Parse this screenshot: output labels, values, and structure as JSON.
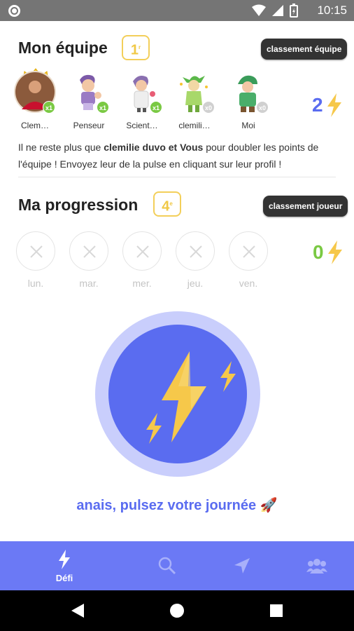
{
  "status_bar": {
    "time": "10:15"
  },
  "team": {
    "title": "Mon équipe",
    "rank": "1",
    "rank_suffix": "r",
    "button_label": "classement équipe",
    "score": "2",
    "members": [
      {
        "name": "Clem…",
        "multiplier": "x1",
        "active": true,
        "crown": true
      },
      {
        "name": "Penseur",
        "multiplier": "x1",
        "active": true
      },
      {
        "name": "Scient…",
        "multiplier": "x1",
        "active": true
      },
      {
        "name": "clemili…",
        "multiplier": "x0",
        "active": false
      },
      {
        "name": "Moi",
        "multiplier": "x0",
        "active": false
      }
    ],
    "message": {
      "prefix": "Il ne reste plus que ",
      "highlight": "clemilie duvo et Vous",
      "suffix": " pour doubler les points de l'équipe ! Envoyez leur de la pulse en cliquant sur leur profil !"
    }
  },
  "progression": {
    "title": "Ma progression",
    "rank": "4",
    "rank_suffix": "e",
    "button_label": "classement joueur",
    "score": "0",
    "days": [
      "lun.",
      "mar.",
      "mer.",
      "jeu.",
      "ven."
    ]
  },
  "cta": {
    "text": "anais, pulsez votre journée 🚀"
  },
  "bottom_nav": {
    "items": [
      {
        "label": "Défi",
        "icon": "bolt-icon",
        "active": true
      },
      {
        "label": "",
        "icon": "search-icon",
        "active": false
      },
      {
        "label": "",
        "icon": "send-icon",
        "active": false
      },
      {
        "label": "",
        "icon": "team-icon",
        "active": false
      }
    ]
  },
  "colors": {
    "primary": "#5a6cf0",
    "nav_bg": "#6b79f5",
    "gold": "#f3cf5a",
    "green": "#7ac943",
    "pulse_halo": "#c9cefc"
  }
}
